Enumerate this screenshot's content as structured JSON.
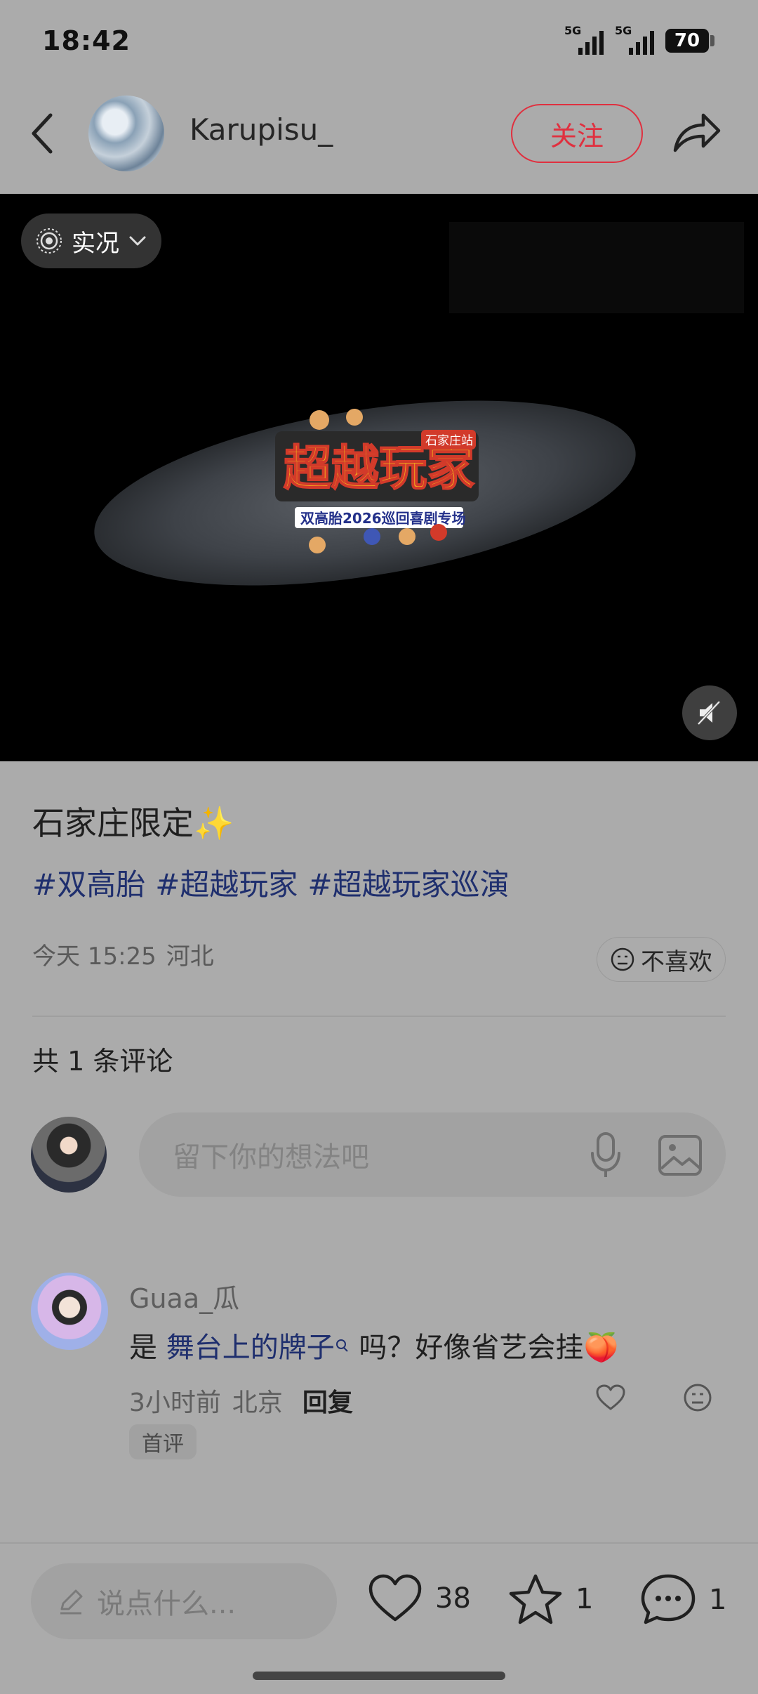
{
  "status_bar": {
    "time": "18:42",
    "signal1_label": "5G",
    "signal2_label": "5G",
    "battery": "70"
  },
  "header": {
    "username": "Karupisu_",
    "follow_label": "关注"
  },
  "media": {
    "live_label": "实况"
  },
  "post": {
    "title": "石家庄限定✨",
    "tags": [
      "#双高胎",
      "#超越玩家",
      "#超越玩家巡演"
    ],
    "time": "今天 15:25",
    "location": "河北",
    "dislike_label": "不喜欢"
  },
  "comments_section": {
    "count_label": "共 1 条评论",
    "input_placeholder": "留下你的想法吧"
  },
  "comment": {
    "user": "Guaa_瓜",
    "text_prefix": "是 ",
    "text_link": "舞台上的牌子",
    "text_suffix": " 吗？好像省艺会挂",
    "emoji": "🍑",
    "time": "3小时前",
    "location": "北京",
    "reply_label": "回复",
    "badge": "首评"
  },
  "bottom_bar": {
    "input_placeholder": "说点什么...",
    "likes": "38",
    "favorites": "1",
    "comments": "1"
  },
  "colors": {
    "accent_red": "#e0303f",
    "tag_blue": "#1f2f6e",
    "overlay_gray": "#ababab"
  },
  "image_text": {
    "logo_main": "超越玩家",
    "logo_sub": "双高胎2026巡回喜剧专场",
    "logo_badge": "石家庄站"
  }
}
